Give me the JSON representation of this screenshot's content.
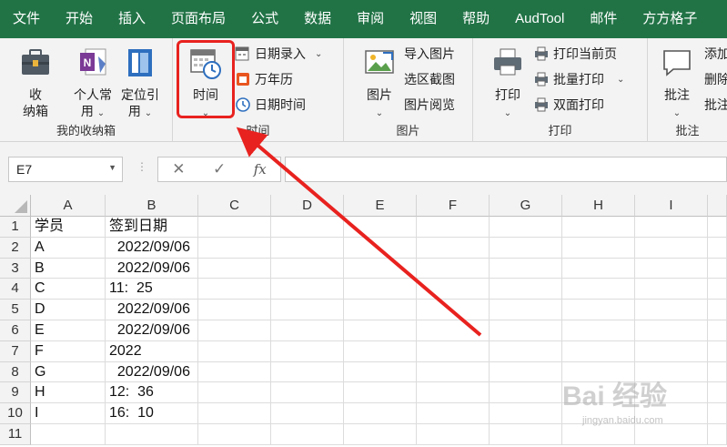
{
  "menu": {
    "tabs": [
      "文件",
      "开始",
      "插入",
      "页面布局",
      "公式",
      "数据",
      "审阅",
      "视图",
      "帮助",
      "AudTool",
      "邮件",
      "方方格子"
    ]
  },
  "ribbon": {
    "group_storage": {
      "label": "我的收纳箱",
      "btn_box": "收\n纳箱",
      "btn_box_l1": "收",
      "btn_box_l2": "纳箱",
      "btn_personal_l1": "个人常",
      "btn_personal_l2": "用",
      "btn_locate_l1": "定位引",
      "btn_locate_l2": "用"
    },
    "group_time": {
      "label": "时间",
      "big_time": "时间",
      "date_entry": "日期录入",
      "calendar": "万年历",
      "datetime": "日期时间"
    },
    "group_picture": {
      "label": "图片",
      "big_picture": "图片",
      "import_picture": "导入图片",
      "select_screenshot": "选区截图",
      "picture_browse": "图片阅览"
    },
    "group_print": {
      "label": "打印",
      "big_print": "打印",
      "print_current": "打印当前页",
      "batch_print": "批量打印",
      "duplex_print": "双面打印"
    },
    "group_comment": {
      "label": "批注",
      "big_comment": "批注",
      "add": "添加",
      "delete": "删除",
      "batch": "批注"
    }
  },
  "formula_bar": {
    "name_box": "E7",
    "cancel": "✕",
    "confirm": "✓",
    "fx": "fx",
    "value": ""
  },
  "sheet": {
    "columns": [
      "A",
      "B",
      "C",
      "D",
      "E",
      "F",
      "G",
      "H",
      "I"
    ],
    "rows": [
      "1",
      "2",
      "3",
      "4",
      "5",
      "6",
      "7",
      "8",
      "9",
      "10",
      "11"
    ],
    "colA": [
      "学员",
      "A",
      "B",
      "C",
      "D",
      "E",
      "F",
      "G",
      "H",
      "I",
      ""
    ],
    "colB": [
      "签到日期",
      "  2022/09/06",
      "  2022/09/06",
      "11:  25",
      "  2022/09/06",
      "  2022/09/06",
      "2022",
      "  2022/09/06",
      "12:  36",
      "16:  10",
      ""
    ]
  },
  "watermark": {
    "brand": "Bai 经验",
    "url": "jingyan.baidu.com"
  },
  "colors": {
    "menubar": "#217346",
    "annotation": "#e8221f"
  }
}
